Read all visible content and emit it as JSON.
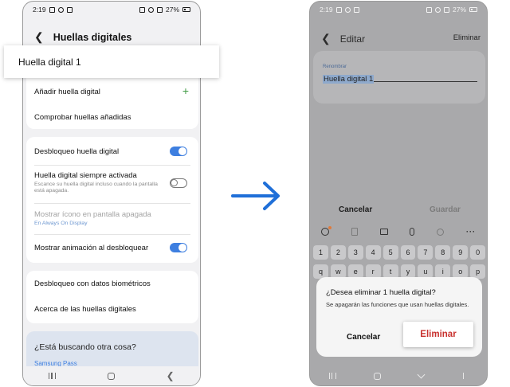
{
  "left_phone": {
    "status": {
      "time": "2:19",
      "battery": "27%"
    },
    "header": {
      "title": "Huellas digitales"
    },
    "highlight": {
      "label": "Huella digital 1"
    },
    "card1": {
      "add_label": "Añadir huella digital",
      "check_label": "Comprobar huellas añadidas"
    },
    "card2": {
      "unlock_label": "Desbloqueo huella digital",
      "unlock_on": true,
      "always_on_label": "Huella digital siempre activada",
      "always_on_sub": "Escance su huella digital incluso cuando la pantalla está apagada.",
      "always_on_on": false,
      "show_icon_label": "Mostrar ícono en pantalla apagada",
      "show_icon_sub": "En Always On Display",
      "animation_label": "Mostrar animación al desbloquear",
      "animation_on": true
    },
    "card3": {
      "biometric_label": "Desbloqueo con datos biométricos",
      "about_label": "Acerca de las huellas digitales"
    },
    "suggest": {
      "title": "¿Está buscando otra cosa?",
      "link": "Samsung Pass"
    }
  },
  "right_phone": {
    "status": {
      "time": "2:19",
      "battery": "27%"
    },
    "header": {
      "title": "Editar",
      "delete_label": "Eliminar"
    },
    "rename": {
      "label": "Renombrar",
      "value": "Huella digital 1"
    },
    "actions": {
      "cancel": "Cancelar",
      "save": "Guardar"
    },
    "keyboard": {
      "number_row": [
        "1",
        "2",
        "3",
        "4",
        "5",
        "6",
        "7",
        "8",
        "9",
        "0"
      ],
      "row2": [
        "q",
        "w",
        "e",
        "r",
        "t",
        "y",
        "u",
        "i",
        "o",
        "p"
      ],
      "toolbar_more": "···"
    },
    "dialog": {
      "title": "¿Desea eliminar 1 huella digital?",
      "body": "Se apagarán las funciones que usan huellas digitales.",
      "cancel": "Cancelar",
      "delete": "Eliminar"
    }
  },
  "colors": {
    "accent_blue": "#3e7fe0",
    "plus_green": "#3f9a43",
    "delete_red": "#c8312e",
    "arrow_blue": "#1f6fd8"
  }
}
